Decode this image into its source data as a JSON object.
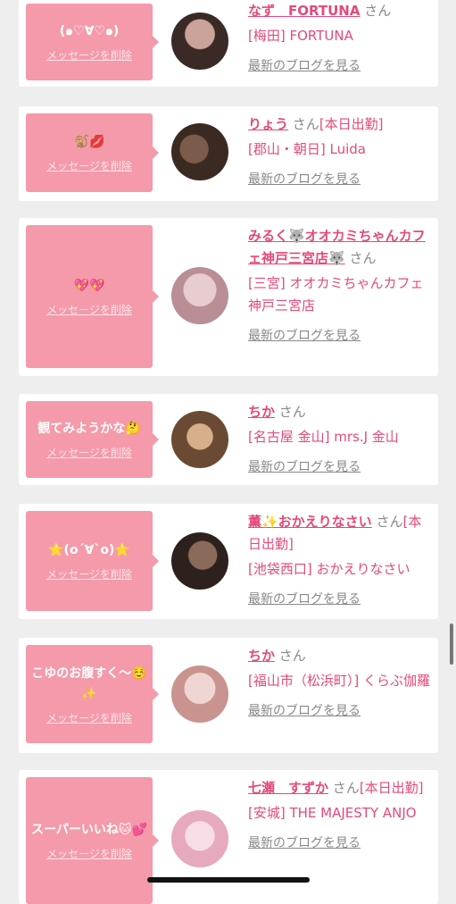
{
  "delete_label": "メッセージを削除",
  "blog_label": "最新のブログを見る",
  "san_label": "さん",
  "cards": [
    {
      "message": "(๑♡∀♡๑)",
      "name": "なず　FORTUNA",
      "extra": "",
      "shop": "[梅田] FORTUNA",
      "avatar_colors": [
        "#caa39a",
        "#3a2a26"
      ]
    },
    {
      "message": "🐒💋",
      "name": "りょう",
      "extra": "[本日出勤]",
      "shop": "[郡山・朝日] Luida",
      "avatar_colors": [
        "#3b2a22",
        "#7a5b4c"
      ]
    },
    {
      "message": "💖💖",
      "name": "みるく🐺オオカミちゃんカフェ神戸三宮店🐺",
      "extra": "",
      "shop": "[三宮] オオカミちゃんカフェ神戸三宮店",
      "avatar_colors": [
        "#e8cdd0",
        "#b98e95"
      ]
    },
    {
      "message": "観てみようかな🤔",
      "name": "ちか",
      "extra": "",
      "shop": "[名古屋 金山] mrs.J 金山",
      "avatar_colors": [
        "#6b4a33",
        "#d6b08a"
      ]
    },
    {
      "message": "⭐️(o´∀`o)⭐️",
      "name": "薫✨おかえりなさい",
      "extra": "[本日出勤]",
      "shop": "[池袋西口] おかえりなさい",
      "avatar_colors": [
        "#2c211c",
        "#8a6a58"
      ]
    },
    {
      "message": "こゆのお腹すく～☺️✨",
      "name": "ちか",
      "extra": "",
      "shop": "[福山市（松浜町）] くらぶ伽羅",
      "avatar_colors": [
        "#f0d6d2",
        "#c9948f"
      ]
    },
    {
      "message": "スーパーいいね🐱💕",
      "name": "七瀬　すずか",
      "extra": "[本日出勤]",
      "shop": "[安城] THE MAJESTY ANJO",
      "avatar_colors": [
        "#f6dde6",
        "#e6a9bd"
      ]
    }
  ]
}
